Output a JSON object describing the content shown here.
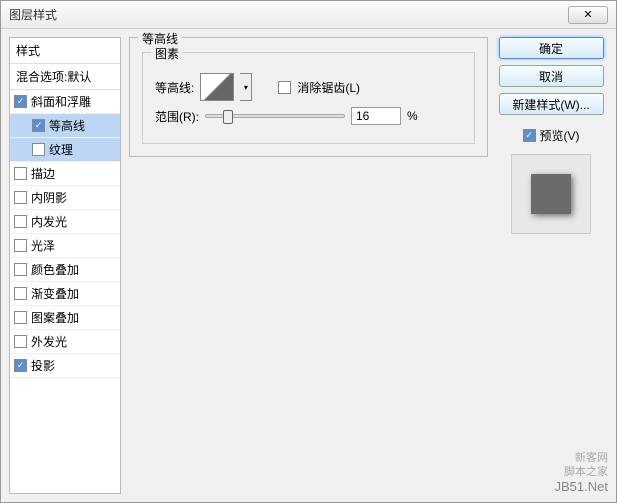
{
  "title": "图层样式",
  "close_glyph": "✕",
  "sidebar": {
    "head": "样式",
    "sub": "混合选项:默认",
    "items": [
      {
        "label": "斜面和浮雕",
        "checked": true,
        "selected": false,
        "indent": false
      },
      {
        "label": "等高线",
        "checked": true,
        "selected": true,
        "indent": true
      },
      {
        "label": "纹理",
        "checked": false,
        "selected": true,
        "indent": true
      },
      {
        "label": "描边",
        "checked": false,
        "selected": false,
        "indent": false
      },
      {
        "label": "内阴影",
        "checked": false,
        "selected": false,
        "indent": false
      },
      {
        "label": "内发光",
        "checked": false,
        "selected": false,
        "indent": false
      },
      {
        "label": "光泽",
        "checked": false,
        "selected": false,
        "indent": false
      },
      {
        "label": "颜色叠加",
        "checked": false,
        "selected": false,
        "indent": false
      },
      {
        "label": "渐变叠加",
        "checked": false,
        "selected": false,
        "indent": false
      },
      {
        "label": "图案叠加",
        "checked": false,
        "selected": false,
        "indent": false
      },
      {
        "label": "外发光",
        "checked": false,
        "selected": false,
        "indent": false
      },
      {
        "label": "投影",
        "checked": true,
        "selected": false,
        "indent": false
      }
    ]
  },
  "main": {
    "group_title": "等高线",
    "elements_title": "图素",
    "contour_label": "等高线:",
    "antialias_label": "消除锯齿(L)",
    "antialias_checked": false,
    "range_label": "范围(R):",
    "range_value": "16",
    "range_unit": "%",
    "slider_pos_pct": 16
  },
  "right": {
    "ok": "确定",
    "cancel": "取消",
    "newstyle": "新建样式(W)...",
    "preview_label": "预览(V)",
    "preview_checked": true
  },
  "watermark": {
    "line1": "新客网",
    "line2": "脚本之家",
    "line3": "JB51.Net"
  }
}
